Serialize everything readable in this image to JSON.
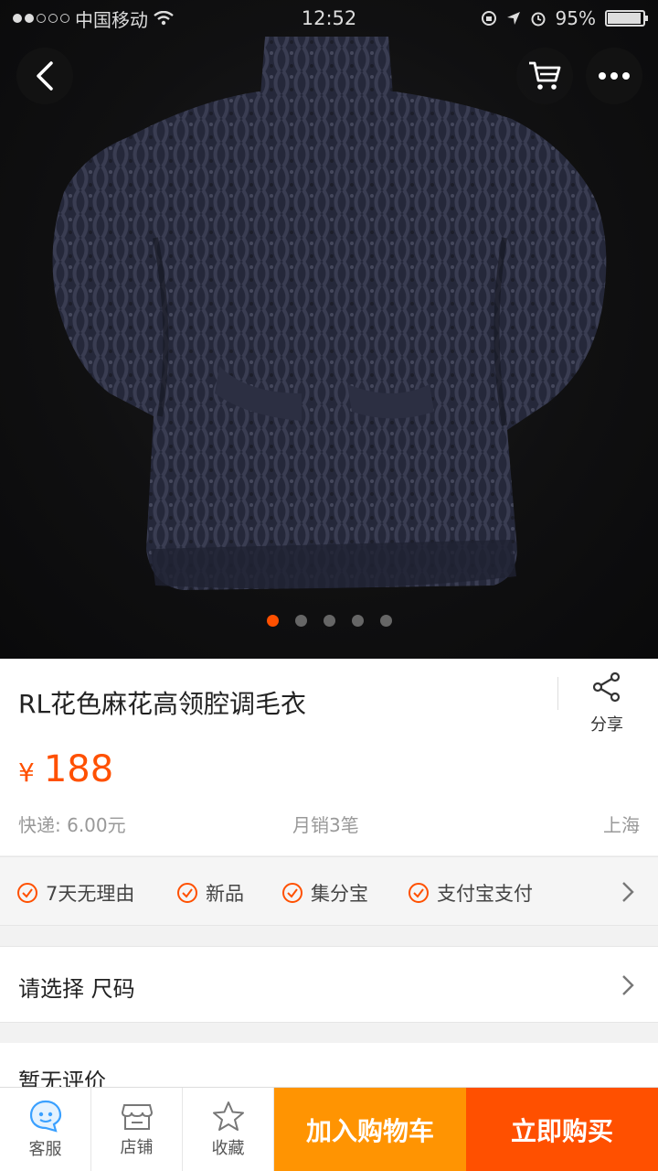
{
  "status_bar": {
    "carrier": "中国移动",
    "time": "12:52",
    "battery_text": "95%",
    "battery_level": 0.95
  },
  "top_bar": {
    "back_icon": "chevron-left-icon",
    "cart_icon": "cart-icon",
    "more_icon": "more-dots-icon"
  },
  "gallery": {
    "image_count": 5,
    "active_index": 0
  },
  "product": {
    "title": "RL花色麻花高领腔调毛衣",
    "currency": "¥",
    "price": "188",
    "shipping": "快递: 6.00元",
    "monthly_sales": "月销3笔",
    "location": "上海"
  },
  "share": {
    "label": "分享",
    "icon": "share-icon"
  },
  "services": [
    {
      "label": "7天无理由",
      "icon": "check-circle-icon"
    },
    {
      "label": "新品",
      "icon": "check-circle-icon"
    },
    {
      "label": "集分宝",
      "icon": "check-circle-icon"
    },
    {
      "label": "支付宝支付",
      "icon": "check-circle-icon"
    }
  ],
  "select_size": {
    "label": "请选择 尺码"
  },
  "reviews": {
    "label": "暂无评价"
  },
  "bottom_bar": {
    "customer_service": "客服",
    "store": "店铺",
    "favorite": "收藏",
    "add_to_cart": "加入购物车",
    "buy_now": "立即购买"
  },
  "colors": {
    "accent": "#ff5000",
    "cart_button": "#ff9402",
    "service_icon": "#ff5000"
  }
}
